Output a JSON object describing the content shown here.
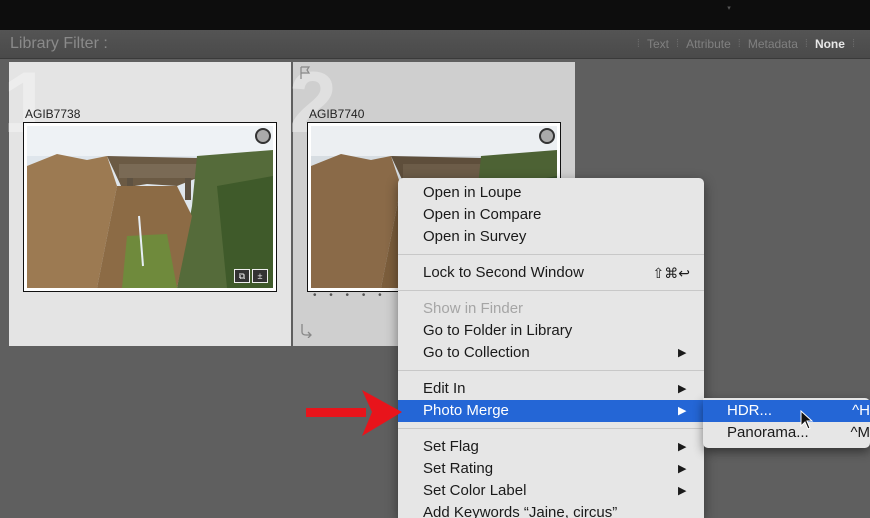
{
  "filter_bar": {
    "title": "Library Filter :",
    "options": [
      "Text",
      "Attribute",
      "Metadata",
      "None"
    ],
    "active_option": "None"
  },
  "grid": {
    "cells": [
      {
        "index": "1",
        "name": "AGIB7738"
      },
      {
        "index": "2",
        "name": "AGIB7740",
        "dots": "• • • • •"
      }
    ]
  },
  "context_menu": {
    "items": [
      {
        "label": "Open in Loupe"
      },
      {
        "label": "Open in Compare"
      },
      {
        "label": "Open in Survey"
      },
      {
        "label": "Lock to Second Window",
        "shortcut": "⇧⌘↩"
      },
      {
        "label": "Show in Finder",
        "disabled": true
      },
      {
        "label": "Go to Folder in Library"
      },
      {
        "label": "Go to Collection",
        "submenu": true
      },
      {
        "label": "Edit In",
        "submenu": true
      },
      {
        "label": "Photo Merge",
        "submenu": true,
        "selected": true
      },
      {
        "label": "Set Flag",
        "submenu": true
      },
      {
        "label": "Set Rating",
        "submenu": true
      },
      {
        "label": "Set Color Label",
        "submenu": true
      },
      {
        "label": "Add Keywords “Jaine, circus”"
      }
    ],
    "arrow_glyph": "▶"
  },
  "photo_merge_submenu": {
    "items": [
      {
        "label": "HDR...",
        "shortcut": "^H",
        "selected": true
      },
      {
        "label": "Panorama...",
        "shortcut": "^M"
      }
    ]
  },
  "colors": {
    "selection": "#2466d6",
    "annotation_arrow": "#e8141b",
    "menu_bg": "#e6e6e6"
  }
}
